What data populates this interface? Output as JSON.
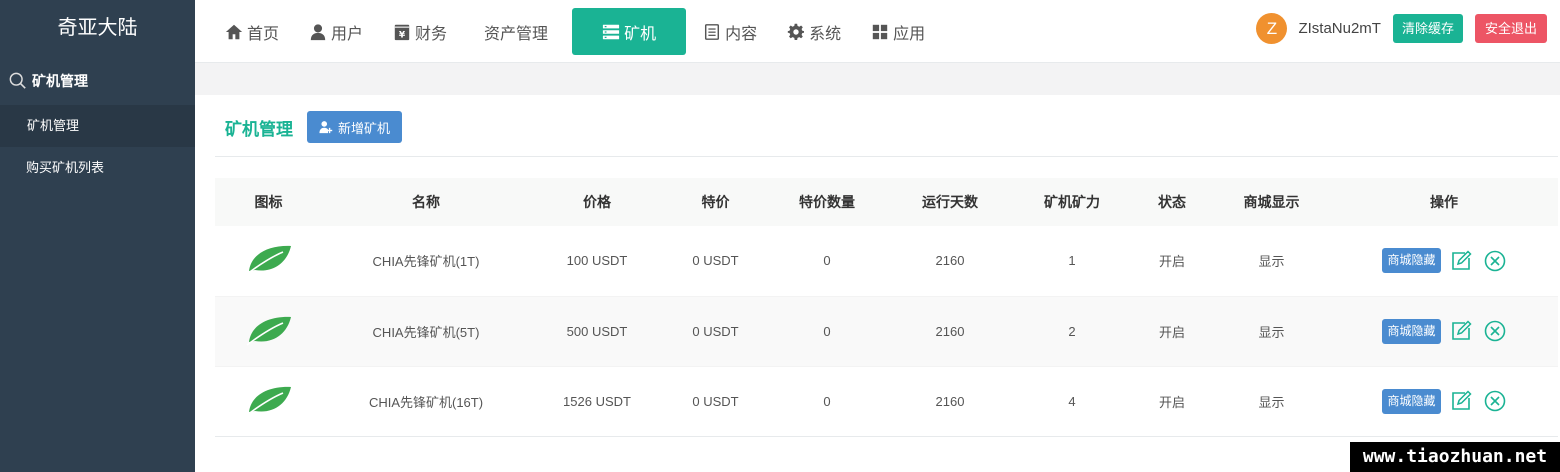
{
  "brand": "奇亚大陆",
  "sidebar": {
    "group_label": "矿机管理",
    "items": [
      {
        "label": "矿机管理"
      },
      {
        "label": "购买矿机列表"
      }
    ]
  },
  "nav": {
    "items": [
      {
        "label": "首页",
        "icon": "home-icon"
      },
      {
        "label": "用户",
        "icon": "user-icon"
      },
      {
        "label": "财务",
        "icon": "finance-icon"
      },
      {
        "label": "资产管理"
      },
      {
        "label": "矿机",
        "icon": "server-icon"
      },
      {
        "label": "内容",
        "icon": "document-icon"
      },
      {
        "label": "系统",
        "icon": "gear-icon"
      },
      {
        "label": "应用",
        "icon": "grid-icon"
      }
    ],
    "active": "矿机"
  },
  "user": {
    "avatar_letter": "Z",
    "name": "ZIstaNu2mT",
    "clear_cache": "清除缓存",
    "logout": "安全退出"
  },
  "page": {
    "title": "矿机管理",
    "add_button": "新增矿机"
  },
  "table": {
    "headers": [
      "图标",
      "名称",
      "价格",
      "特价",
      "特价数量",
      "运行天数",
      "矿机矿力",
      "状态",
      "商城显示",
      "操作"
    ],
    "rows": [
      {
        "name": "CHIA先锋矿机(1T)",
        "price": "100 USDT",
        "special": "0 USDT",
        "special_qty": "0",
        "days": "2160",
        "power": "1",
        "status": "开启",
        "shop": "显示",
        "hide_btn": "商城隐藏"
      },
      {
        "name": "CHIA先锋矿机(5T)",
        "price": "500 USDT",
        "special": "0 USDT",
        "special_qty": "0",
        "days": "2160",
        "power": "2",
        "status": "开启",
        "shop": "显示",
        "hide_btn": "商城隐藏"
      },
      {
        "name": "CHIA先锋矿机(16T)",
        "price": "1526 USDT",
        "special": "0 USDT",
        "special_qty": "0",
        "days": "2160",
        "power": "4",
        "status": "开启",
        "shop": "显示",
        "hide_btn": "商城隐藏"
      }
    ]
  },
  "watermark": "www.tiaozhuan.net",
  "colors": {
    "sidebar_bg": "#2f4050",
    "accent": "#1ab394",
    "primary_button": "#4a8bd0",
    "danger": "#ed5565",
    "avatar": "#f0912f",
    "leaf": "#3daa4f"
  }
}
